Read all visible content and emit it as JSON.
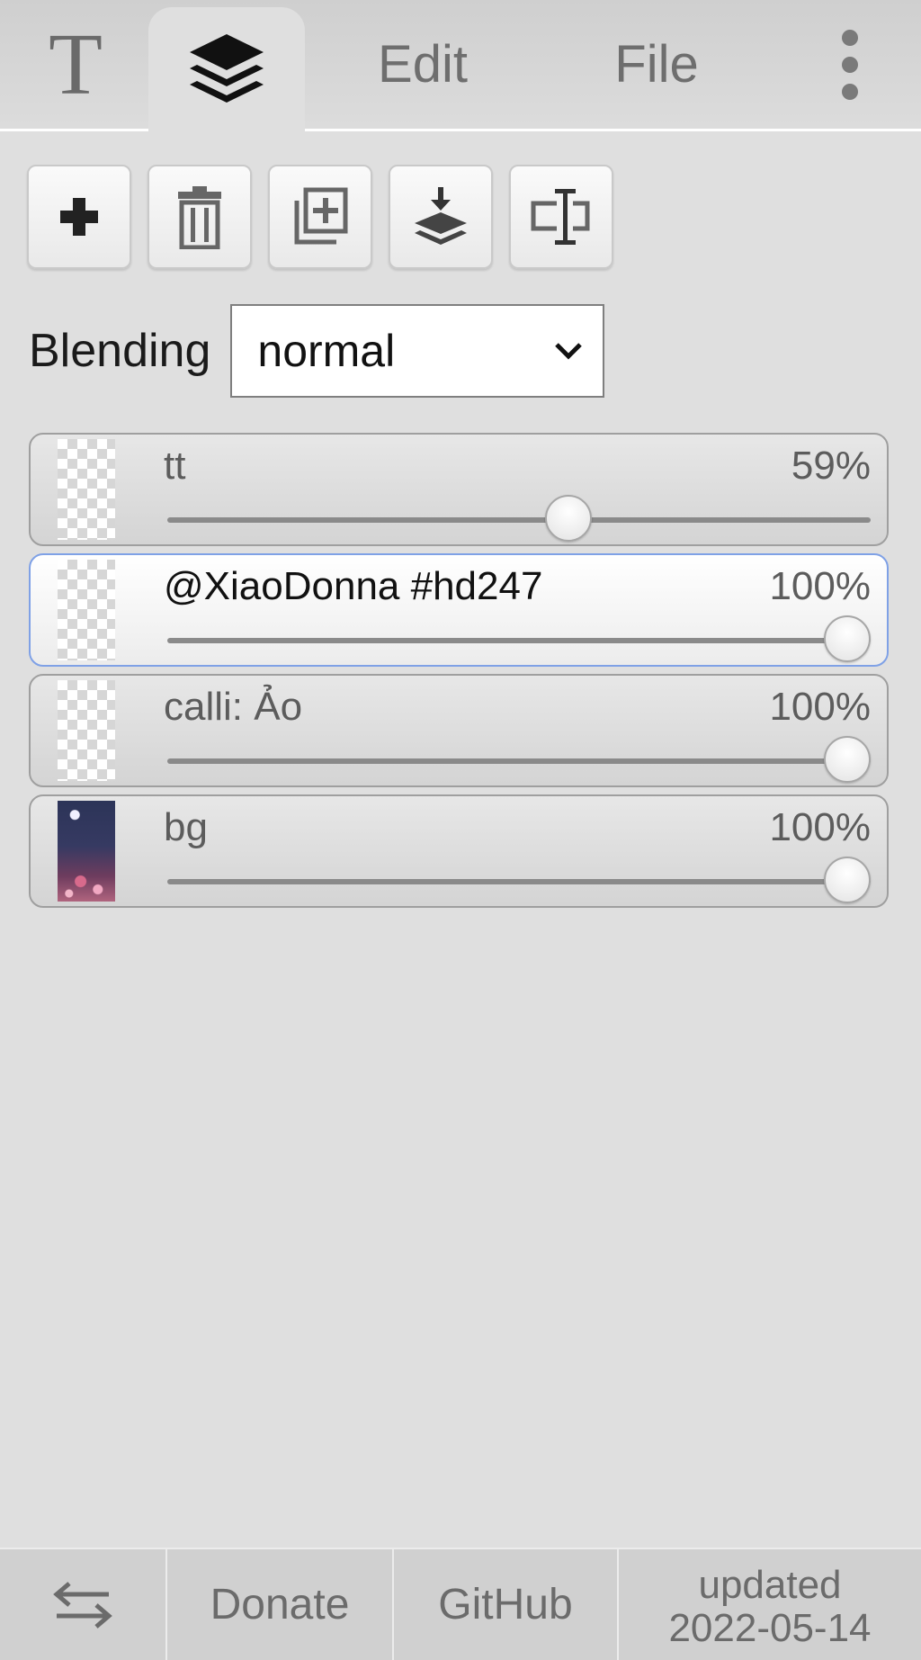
{
  "tabs": {
    "text_tab_glyph": "T",
    "layers_tab_icon": "layers-icon",
    "edit_label": "Edit",
    "file_label": "File",
    "more_icon": "more-vertical-icon"
  },
  "toolbar": {
    "buttons": [
      {
        "icon": "add-layer-icon"
      },
      {
        "icon": "delete-layer-icon"
      },
      {
        "icon": "duplicate-layer-icon"
      },
      {
        "icon": "merge-down-icon"
      },
      {
        "icon": "rename-layer-icon"
      }
    ]
  },
  "blending": {
    "label": "Blending",
    "selected": "normal",
    "dropdown_icon": "chevron-down-icon"
  },
  "layers": [
    {
      "name": "tt",
      "opacity": 59,
      "opacity_label": "59%",
      "active": false,
      "thumb": "checker"
    },
    {
      "name": "@XiaoDonna #hd247",
      "opacity": 100,
      "opacity_label": "100%",
      "active": true,
      "thumb": "checker"
    },
    {
      "name": "calli: Ảo",
      "opacity": 100,
      "opacity_label": "100%",
      "active": false,
      "thumb": "checker"
    },
    {
      "name": "bg",
      "opacity": 100,
      "opacity_label": "100%",
      "active": false,
      "thumb": "photo"
    }
  ],
  "footer": {
    "swap_icon": "swap-arrows-icon",
    "donate_label": "Donate",
    "github_label": "GitHub",
    "updated_line1": "updated",
    "updated_line2": "2022-05-14"
  },
  "colors": {
    "background": "#dfdfdf",
    "active_layer_border": "#7fa1e6"
  }
}
